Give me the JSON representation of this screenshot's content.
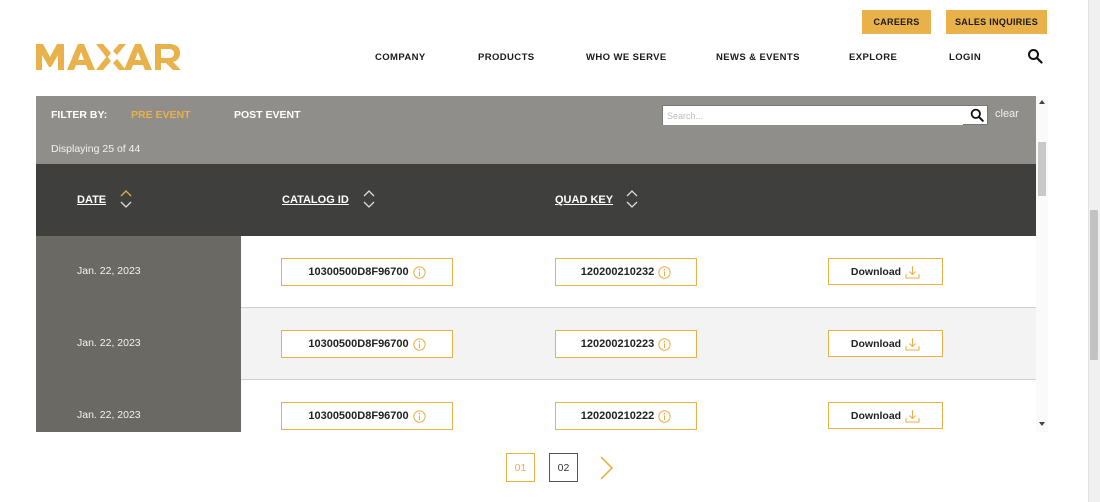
{
  "header": {
    "careers_label": "CAREERS",
    "sales_label": "SALES INQUIRIES",
    "logo_text": "MAXAR",
    "nav": [
      "COMPANY",
      "PRODUCTS",
      "WHO WE SERVE",
      "NEWS & EVENTS",
      "EXPLORE",
      "LOGIN"
    ],
    "search_icon": "search-icon"
  },
  "filter": {
    "label": "FILTER BY:",
    "pre_event": "PRE EVENT",
    "post_event": "POST EVENT",
    "search_placeholder": "Search...",
    "clear_label": "clear",
    "display_count": "Displaying 25 of 44",
    "active_color": "#E8B14A"
  },
  "table": {
    "columns": [
      "DATE",
      "CATALOG ID",
      "QUAD KEY"
    ],
    "rows": [
      {
        "date": "Jan. 22, 2023",
        "catalog_id": "10300500D8F96700",
        "quad_key": "120200210232",
        "action": "Download"
      },
      {
        "date": "Jan. 22, 2023",
        "catalog_id": "10300500D8F96700",
        "quad_key": "120200210223",
        "action": "Download"
      },
      {
        "date": "Jan. 22, 2023",
        "catalog_id": "10300500D8F96700",
        "quad_key": "120200210222",
        "action": "Download"
      }
    ]
  },
  "pagination": {
    "pages": [
      "01",
      "02"
    ],
    "current": "01"
  },
  "colors": {
    "accent": "#E8B14A",
    "filter_bg": "#8f8e8a",
    "header_bg": "#3f3f3e",
    "date_bg": "#6a6964"
  }
}
